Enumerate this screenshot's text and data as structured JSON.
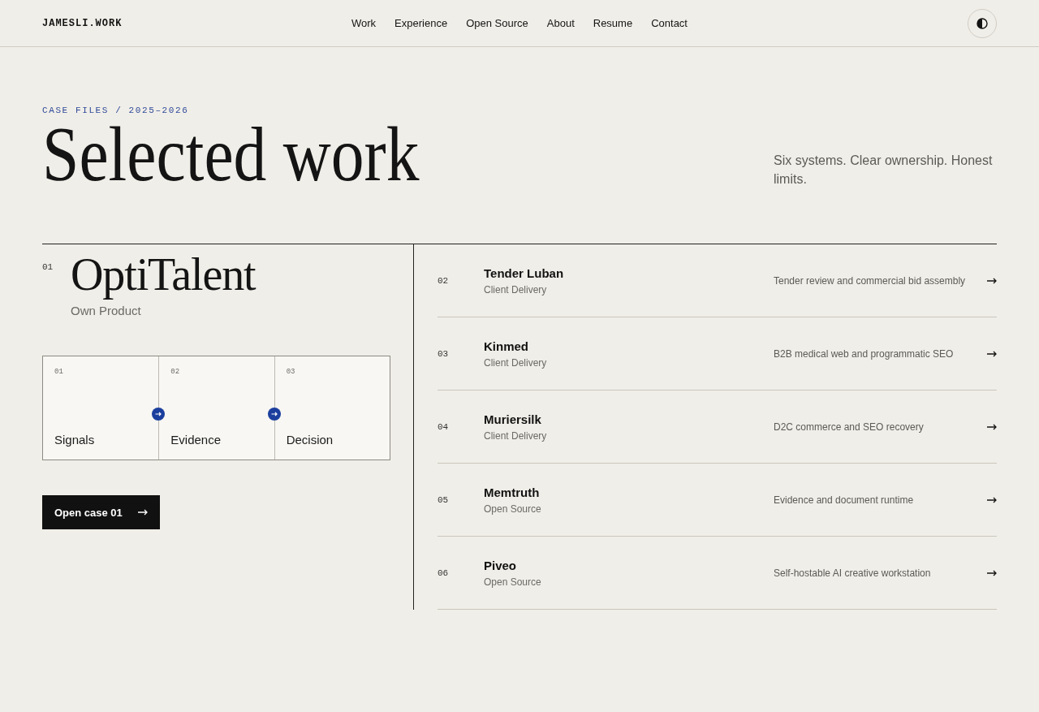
{
  "header": {
    "logo": "JAMESLI.WORK",
    "nav": [
      "Work",
      "Experience",
      "Open Source",
      "About",
      "Resume",
      "Contact"
    ]
  },
  "hero": {
    "eyebrow": "CASE FILES / 2025–2026",
    "title": "Selected work",
    "tagline": "Six systems. Clear ownership. Honest limits."
  },
  "featured_case": {
    "number": "01",
    "name": "OptiTalent",
    "category": "Own Product",
    "flow": [
      {
        "number": "01",
        "label": "Signals"
      },
      {
        "number": "02",
        "label": "Evidence"
      },
      {
        "number": "03",
        "label": "Decision"
      }
    ],
    "button": "Open case 01"
  },
  "cases": [
    {
      "number": "02",
      "name": "Tender Luban",
      "category": "Client Delivery",
      "summary": "Tender review and commercial bid assembly"
    },
    {
      "number": "03",
      "name": "Kinmed",
      "category": "Client Delivery",
      "summary": "B2B medical web and programmatic SEO"
    },
    {
      "number": "04",
      "name": "Muriersilk",
      "category": "Client Delivery",
      "summary": "D2C commerce and SEO recovery"
    },
    {
      "number": "05",
      "name": "Memtruth",
      "category": "Open Source",
      "summary": "Evidence and document runtime"
    },
    {
      "number": "06",
      "name": "Piveo",
      "category": "Open Source",
      "summary": "Self-hostable AI creative workstation"
    }
  ]
}
